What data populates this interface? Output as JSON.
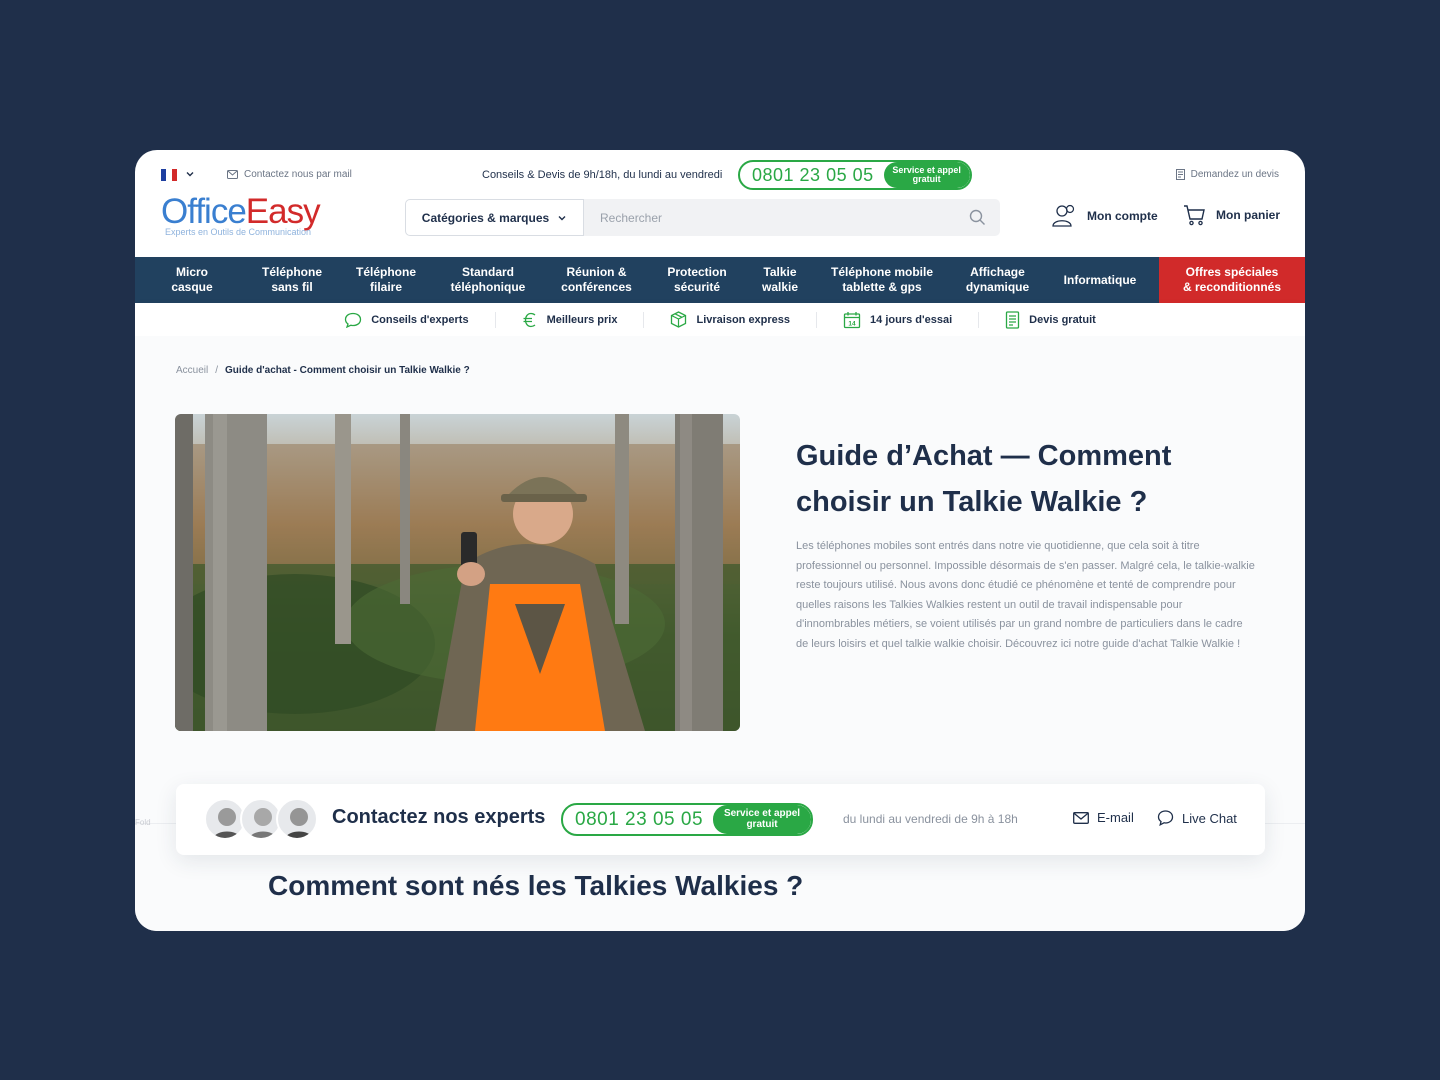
{
  "colors": {
    "page_bg": "#1f2f4a",
    "nav_bg": "#21415f",
    "accent_green": "#2aa845",
    "promo_red": "#d12a2a",
    "logo_blue": "#3a7fd0",
    "logo_red": "#d22a2a"
  },
  "topbar": {
    "language_flag": "flag-fr-icon",
    "contact_mail": "Contactez nous par mail",
    "hours": "Conseils & Devis de 9h/18h, du lundi au vendredi",
    "phone": "0801 23 05 05",
    "phone_badge": "Service et appel gratuit",
    "quote_link": "Demandez un devis"
  },
  "logo": {
    "part1": "Office",
    "part2": "Easy",
    "tagline": "Experts en Outils de Communication"
  },
  "header": {
    "categories_label": "Catégories & marques",
    "search_placeholder": "Rechercher",
    "account_label": "Mon compte",
    "cart_label": "Mon panier"
  },
  "nav": {
    "items": [
      {
        "line1": "Micro",
        "line2": "casque"
      },
      {
        "line1": "Téléphone",
        "line2": "sans fil"
      },
      {
        "line1": "Téléphone",
        "line2": "filaire"
      },
      {
        "line1": "Standard",
        "line2": "téléphonique"
      },
      {
        "line1": "Réunion &",
        "line2": "conférences"
      },
      {
        "line1": "Protection",
        "line2": "sécurité"
      },
      {
        "line1": "Talkie",
        "line2": "walkie"
      },
      {
        "line1": "Téléphone mobile",
        "line2": "tablette & gps"
      },
      {
        "line1": "Affichage",
        "line2": "dynamique"
      },
      {
        "line1": "Informatique",
        "line2": ""
      }
    ],
    "promo": {
      "line1": "Offres spéciales",
      "line2": "& reconditionnés"
    }
  },
  "usp": [
    {
      "label": "Conseils d'experts",
      "icon": "chat-bubble-icon"
    },
    {
      "label": "Meilleurs prix",
      "icon": "euro-icon"
    },
    {
      "label": "Livraison express",
      "icon": "box-icon"
    },
    {
      "label": "14 jours d'essai",
      "icon": "calendar-icon",
      "icon_text": "14"
    },
    {
      "label": "Devis gratuit",
      "icon": "document-icon"
    }
  ],
  "breadcrumb": {
    "home": "Accueil",
    "separator": "/",
    "current": "Guide d'achat - Comment choisir un Talkie Walkie ?"
  },
  "article": {
    "title_line1": "Guide d’Achat — Comment",
    "title_line2": "choisir un Talkie Walkie ?",
    "intro": "Les téléphones mobiles sont entrés dans notre vie quotidienne, que cela soit à titre professionnel ou personnel. Impossible désormais de s'en passer. Malgré cela, le talkie-walkie reste toujours utilisé. Nous avons donc étudié ce phénomène et tenté de comprendre pour quelles raisons les Talkies Walkies restent un outil de travail indispensable pour d'innombrables métiers, se voient utilisés par un grand nombre de particuliers dans le cadre de leurs loisirs et quel talkie walkie choisir. Découvrez ici notre guide d'achat Talkie Walkie !",
    "next_heading": "Comment sont nés les Talkies Walkies ?"
  },
  "experts": {
    "title": "Contactez nos experts",
    "phone": "0801 23 05 05",
    "phone_badge": "Service et appel gratuit",
    "hours": "du lundi au vendredi de 9h à 18h",
    "email_label": "E-mail",
    "chat_label": "Live Chat"
  },
  "fold_label": "Fold"
}
